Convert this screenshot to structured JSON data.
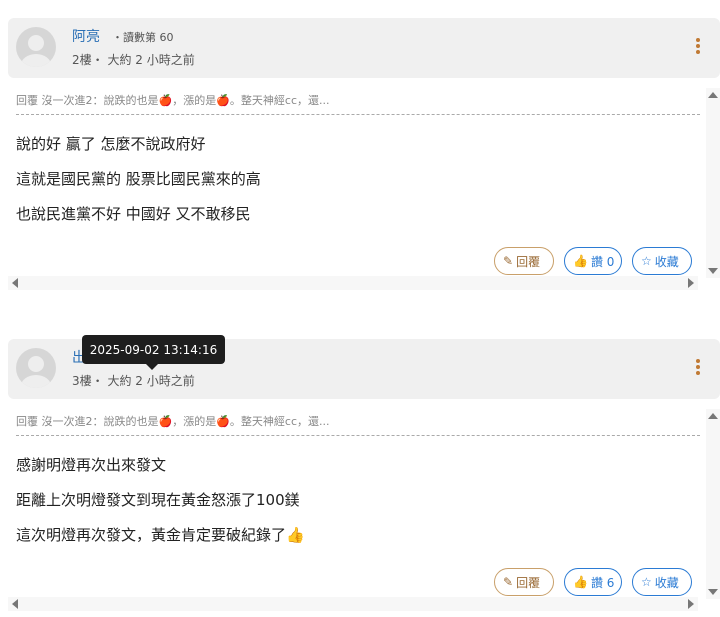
{
  "posts": [
    {
      "author": "阿亮",
      "rank": "・讀數第 60",
      "floor": "2樓",
      "sep": "・",
      "time": "大約 2 小時之前",
      "quote_prefix": "回覆 沒一次進2：說跌的也是",
      "quote_mid": "，漲的是",
      "quote_suffix": "。整天神經cc，還...",
      "lines": [
        "說的好 贏了 怎麼不說政府好",
        "這就是國民黨的 股票比國民黨來的高",
        "也說民進黨不好 中國好 又不敢移民"
      ],
      "reply_label": "回覆",
      "like_label": "讚 0",
      "fav_label": "收藏"
    },
    {
      "author": "出",
      "floor": "3樓",
      "sep": "・",
      "time": "大約 2 小時之前",
      "quote_prefix": "回覆 沒一次進2：說跌的也是",
      "quote_mid": "，漲的是",
      "quote_suffix": "。整天神經cc，還...",
      "lines": [
        "感謝明燈再次出來發文",
        "距離上次明燈發文到現在黃金怒漲了100鎂",
        "這次明燈再次發文，黃金肯定要破紀錄了"
      ],
      "reply_label": "回覆",
      "like_label": "讚 6",
      "fav_label": "收藏"
    }
  ],
  "tooltip": "2025-09-02 13:14:16",
  "icons": {
    "apple": "red-apple-icon",
    "thumbs_up": "thumbs-up-emoji-icon",
    "pencil": "pencil-icon",
    "like": "thumbs-up-outline-icon",
    "star": "star-outline-icon",
    "kebab": "kebab-menu-icon"
  },
  "colors": {
    "author": "#2a6fb5",
    "accent_blue": "#2b7bd4",
    "reply_brown": "#9a6a34",
    "header_bg": "#f0f0f0"
  }
}
